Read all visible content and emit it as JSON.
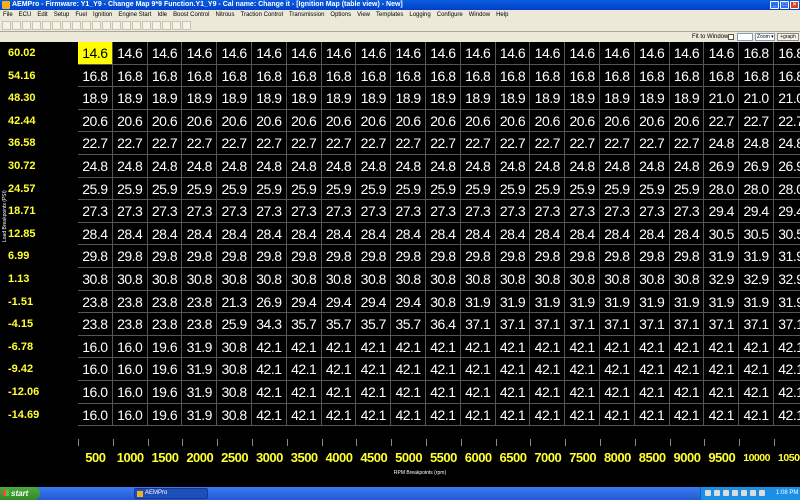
{
  "window": {
    "title": "AEMPro - Firmware: Y1_Y9 - Change Map 9*9 Function.Y1_Y9 - Cal name: Change it - [Ignition Map (table view) - New]",
    "controls": [
      "_",
      "□",
      "×"
    ]
  },
  "menu": [
    "File",
    "ECU",
    "Edit",
    "Setup",
    "Fuel",
    "Ignition",
    "Engine Start",
    "Idle",
    "Boost Control",
    "Nitrous",
    "Traction Control",
    "Transmission",
    "Options",
    "View",
    "Templates",
    "Logging",
    "Configure",
    "Window",
    "Help"
  ],
  "fitbar": {
    "fit_label": "Fit to Window",
    "zoom_label": "Zoom ▾",
    "graph_label": "+graph"
  },
  "table": {
    "load_axis_label": "Load Breakpoints (PSI)",
    "rpm_axis_label": "RPM Breakpoints (rpm)",
    "row_labels": [
      "60.02",
      "54.16",
      "48.30",
      "42.44",
      "36.58",
      "30.72",
      "24.57",
      "18.71",
      "12.85",
      "6.99",
      "1.13",
      "-1.51",
      "-4.15",
      "-6.78",
      "-9.42",
      "-12.06",
      "-14.69"
    ],
    "col_labels": [
      "500",
      "1000",
      "1500",
      "2000",
      "2500",
      "3000",
      "3500",
      "4000",
      "4500",
      "5000",
      "5500",
      "6000",
      "6500",
      "7000",
      "7500",
      "8000",
      "8500",
      "9000",
      "9500",
      "10000",
      "10500"
    ],
    "rows": [
      [
        "14.6",
        "14.6",
        "14.6",
        "14.6",
        "14.6",
        "14.6",
        "14.6",
        "14.6",
        "14.6",
        "14.6",
        "14.6",
        "14.6",
        "14.6",
        "14.6",
        "14.6",
        "14.6",
        "14.6",
        "14.6",
        "14.6",
        "16.8",
        "16.8"
      ],
      [
        "16.8",
        "16.8",
        "16.8",
        "16.8",
        "16.8",
        "16.8",
        "16.8",
        "16.8",
        "16.8",
        "16.8",
        "16.8",
        "16.8",
        "16.8",
        "16.8",
        "16.8",
        "16.8",
        "16.8",
        "16.8",
        "16.8",
        "16.8",
        "16.8"
      ],
      [
        "18.9",
        "18.9",
        "18.9",
        "18.9",
        "18.9",
        "18.9",
        "18.9",
        "18.9",
        "18.9",
        "18.9",
        "18.9",
        "18.9",
        "18.9",
        "18.9",
        "18.9",
        "18.9",
        "18.9",
        "18.9",
        "21.0",
        "21.0",
        "21.0"
      ],
      [
        "20.6",
        "20.6",
        "20.6",
        "20.6",
        "20.6",
        "20.6",
        "20.6",
        "20.6",
        "20.6",
        "20.6",
        "20.6",
        "20.6",
        "20.6",
        "20.6",
        "20.6",
        "20.6",
        "20.6",
        "20.6",
        "22.7",
        "22.7",
        "22.7"
      ],
      [
        "22.7",
        "22.7",
        "22.7",
        "22.7",
        "22.7",
        "22.7",
        "22.7",
        "22.7",
        "22.7",
        "22.7",
        "22.7",
        "22.7",
        "22.7",
        "22.7",
        "22.7",
        "22.7",
        "22.7",
        "22.7",
        "24.8",
        "24.8",
        "24.8"
      ],
      [
        "24.8",
        "24.8",
        "24.8",
        "24.8",
        "24.8",
        "24.8",
        "24.8",
        "24.8",
        "24.8",
        "24.8",
        "24.8",
        "24.8",
        "24.8",
        "24.8",
        "24.8",
        "24.8",
        "24.8",
        "24.8",
        "26.9",
        "26.9",
        "26.9"
      ],
      [
        "25.9",
        "25.9",
        "25.9",
        "25.9",
        "25.9",
        "25.9",
        "25.9",
        "25.9",
        "25.9",
        "25.9",
        "25.9",
        "25.9",
        "25.9",
        "25.9",
        "25.9",
        "25.9",
        "25.9",
        "25.9",
        "28.0",
        "28.0",
        "28.0"
      ],
      [
        "27.3",
        "27.3",
        "27.3",
        "27.3",
        "27.3",
        "27.3",
        "27.3",
        "27.3",
        "27.3",
        "27.3",
        "27.3",
        "27.3",
        "27.3",
        "27.3",
        "27.3",
        "27.3",
        "27.3",
        "27.3",
        "29.4",
        "29.4",
        "29.4"
      ],
      [
        "28.4",
        "28.4",
        "28.4",
        "28.4",
        "28.4",
        "28.4",
        "28.4",
        "28.4",
        "28.4",
        "28.4",
        "28.4",
        "28.4",
        "28.4",
        "28.4",
        "28.4",
        "28.4",
        "28.4",
        "28.4",
        "30.5",
        "30.5",
        "30.5"
      ],
      [
        "29.8",
        "29.8",
        "29.8",
        "29.8",
        "29.8",
        "29.8",
        "29.8",
        "29.8",
        "29.8",
        "29.8",
        "29.8",
        "29.8",
        "29.8",
        "29.8",
        "29.8",
        "29.8",
        "29.8",
        "29.8",
        "31.9",
        "31.9",
        "31.9"
      ],
      [
        "30.8",
        "30.8",
        "30.8",
        "30.8",
        "30.8",
        "30.8",
        "30.8",
        "30.8",
        "30.8",
        "30.8",
        "30.8",
        "30.8",
        "30.8",
        "30.8",
        "30.8",
        "30.8",
        "30.8",
        "30.8",
        "32.9",
        "32.9",
        "32.9"
      ],
      [
        "23.8",
        "23.8",
        "23.8",
        "23.8",
        "21.3",
        "26.9",
        "29.4",
        "29.4",
        "29.4",
        "29.4",
        "30.8",
        "31.9",
        "31.9",
        "31.9",
        "31.9",
        "31.9",
        "31.9",
        "31.9",
        "31.9",
        "31.9",
        "31.9"
      ],
      [
        "23.8",
        "23.8",
        "23.8",
        "23.8",
        "25.9",
        "34.3",
        "35.7",
        "35.7",
        "35.7",
        "35.7",
        "36.4",
        "37.1",
        "37.1",
        "37.1",
        "37.1",
        "37.1",
        "37.1",
        "37.1",
        "37.1",
        "37.1",
        "37.1"
      ],
      [
        "16.0",
        "16.0",
        "19.6",
        "31.9",
        "30.8",
        "42.1",
        "42.1",
        "42.1",
        "42.1",
        "42.1",
        "42.1",
        "42.1",
        "42.1",
        "42.1",
        "42.1",
        "42.1",
        "42.1",
        "42.1",
        "42.1",
        "42.1",
        "42.1"
      ],
      [
        "16.0",
        "16.0",
        "19.6",
        "31.9",
        "30.8",
        "42.1",
        "42.1",
        "42.1",
        "42.1",
        "42.1",
        "42.1",
        "42.1",
        "42.1",
        "42.1",
        "42.1",
        "42.1",
        "42.1",
        "42.1",
        "42.1",
        "42.1",
        "42.1"
      ],
      [
        "16.0",
        "16.0",
        "19.6",
        "31.9",
        "30.8",
        "42.1",
        "42.1",
        "42.1",
        "42.1",
        "42.1",
        "42.1",
        "42.1",
        "42.1",
        "42.1",
        "42.1",
        "42.1",
        "42.1",
        "42.1",
        "42.1",
        "42.1",
        "42.1"
      ],
      [
        "16.0",
        "16.0",
        "19.6",
        "31.9",
        "30.8",
        "42.1",
        "42.1",
        "42.1",
        "42.1",
        "42.1",
        "42.1",
        "42.1",
        "42.1",
        "42.1",
        "42.1",
        "42.1",
        "42.1",
        "42.1",
        "42.1",
        "42.1",
        "42.1"
      ]
    ],
    "selected_row": 0,
    "selected_col": 0
  },
  "taskbar": {
    "start_label": "start",
    "task_label": "AEMPro",
    "clock": "1:08 PM"
  }
}
